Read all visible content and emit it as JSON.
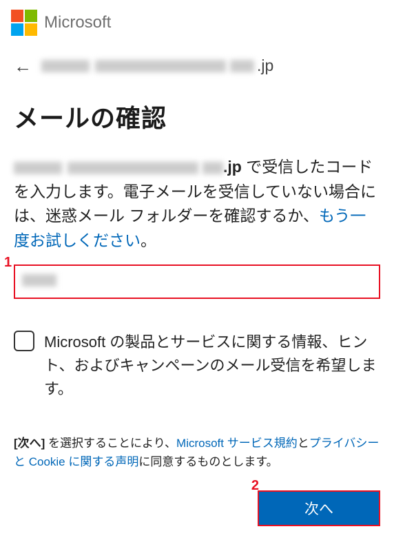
{
  "header": {
    "brand_text": "Microsoft"
  },
  "email_row": {
    "suffix": ".jp"
  },
  "title": "メールの確認",
  "desc": {
    "suffix": ".jp",
    "text1": " で受信したコードを入力します。電子メールを受信していない場合には、迷惑メール フォルダーを確認するか、",
    "retry_link": "もう一度お試しください",
    "period": "。"
  },
  "annotations": {
    "one": "1",
    "two": "2"
  },
  "input": {
    "aria": "code-input"
  },
  "checkbox": {
    "label": "Microsoft の製品とサービスに関する情報、ヒント、およびキャンペーンのメール受信を希望します。"
  },
  "terms": {
    "bold": "[次へ]",
    "t1": " を選択することにより、",
    "link1": "Microsoft サービス規約",
    "t2": "と",
    "link2": "プライバシーと Cookie に関する声明",
    "t3": "に同意するものとします。"
  },
  "button": {
    "next": "次へ"
  }
}
